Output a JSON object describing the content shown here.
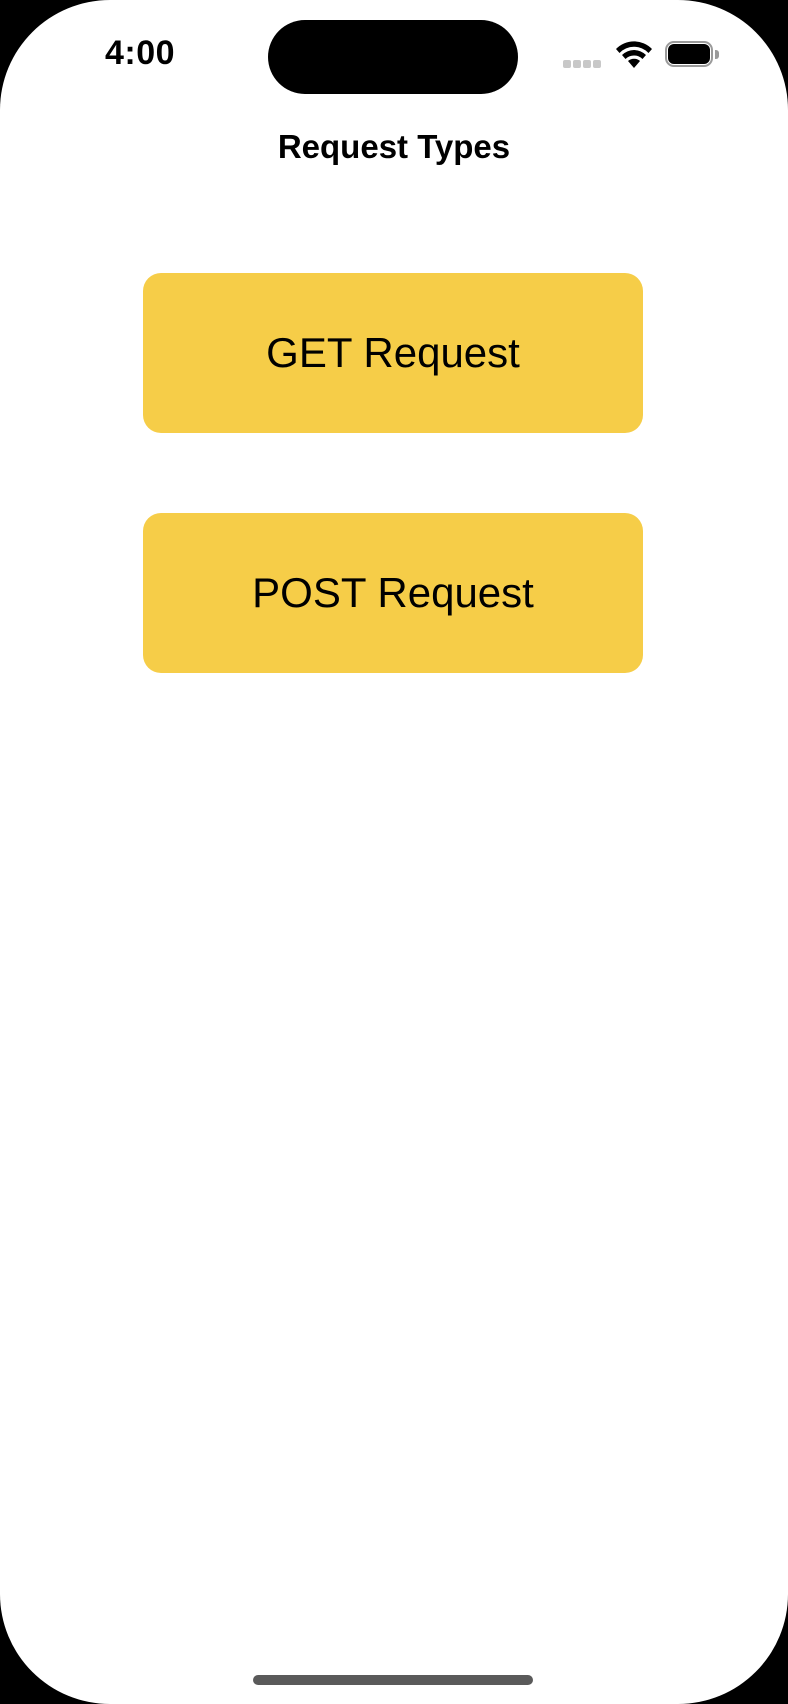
{
  "status_bar": {
    "time": "4:00"
  },
  "navigation": {
    "title": "Request Types"
  },
  "buttons": {
    "get_label": "GET Request",
    "post_label": "POST Request"
  },
  "colors": {
    "accent": "#f6cd48",
    "background": "#ffffff",
    "text": "#000000"
  },
  "icons": [
    "cellular-signal-icon",
    "wifi-icon",
    "battery-icon"
  ]
}
